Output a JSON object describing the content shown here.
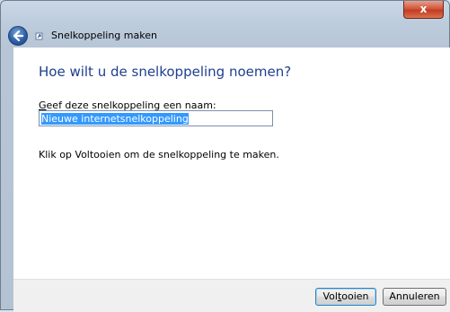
{
  "window": {
    "title": "Snelkoppeling maken",
    "close_label": "x"
  },
  "main": {
    "heading": "Hoe wilt u de snelkoppeling noemen?",
    "name_label_access": "G",
    "name_label_rest": "eef deze snelkoppeling een naam:",
    "name_value": "Nieuwe internetsnelkoppeling",
    "instruction": "Klik op Voltooien om de snelkoppeling te maken."
  },
  "footer": {
    "finish_label_pre": "Vol",
    "finish_label_access": "t",
    "finish_label_post": "ooien",
    "cancel_label": "Annuleren"
  }
}
